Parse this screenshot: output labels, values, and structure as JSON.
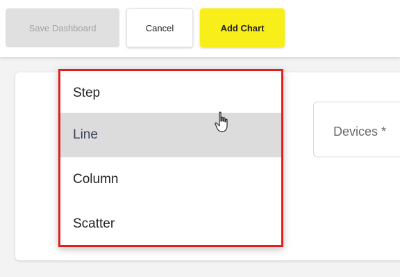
{
  "toolbar": {
    "save_label": "Save Dashboard",
    "cancel_label": "Cancel",
    "add_chart_label": "Add Chart"
  },
  "form": {
    "devices_label": "Devices *"
  },
  "chart_type_menu": {
    "items": [
      {
        "label": "Step"
      },
      {
        "label": "Line",
        "selected": true
      },
      {
        "label": "Column"
      },
      {
        "label": "Scatter"
      }
    ],
    "highlight_color": "#e02020"
  },
  "colors": {
    "accent_yellow": "#f7ee1a",
    "disabled_gray": "#e0e0e0"
  },
  "cursor": {
    "icon": "hand-pointer-icon"
  }
}
